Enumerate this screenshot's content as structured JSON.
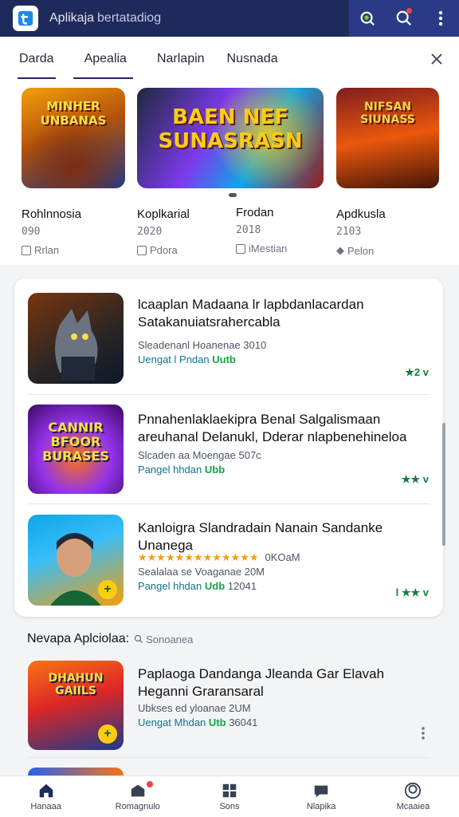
{
  "header": {
    "title": "Aplikaja",
    "subtitle": "bertatadiog"
  },
  "tabs": [
    {
      "label": "Darda"
    },
    {
      "label": "Apealia"
    },
    {
      "label": "Narlapin"
    },
    {
      "label": "Nusnada"
    }
  ],
  "featured": [
    {
      "art_text": "MINHER UNBANAS",
      "name": "Rohlnnosia",
      "year": "090",
      "meta": "Rrlan"
    },
    {
      "art_text": "BAEN NEF SUNASRASN",
      "name": "Koplkarial",
      "year": "2020",
      "meta": "Pdora"
    },
    {
      "art_text": "",
      "name": "Frodan",
      "year": "2018",
      "meta": "iMestian"
    },
    {
      "art_text": "NIFSAN SIUNASS",
      "name": "Apdkusla",
      "year": "2103",
      "meta": "Pelon"
    }
  ],
  "list": [
    {
      "title": "lcaaplan Madaana lr lapbdanlacardan Satakanuiatsrahercabla",
      "meta1": "Sleadenanl Hoanenae 3010",
      "meta2": "Uengat l Pndan",
      "meta2_green": "Uutb",
      "rating": "★2 v"
    },
    {
      "title": "Pnnahenlaklaekipra Benal Salgalismaan areuhanal Delanukl, Dderar nlapbenehineloa",
      "meta1": "Slcaden aa Moengae 507c",
      "meta2": "Pangel hhdan",
      "meta2_green": "Ubb",
      "rating": "★★ v",
      "art_text": "CANNIR BFOOR BURASES"
    },
    {
      "title": "Kanloigra Slandradain Nanain Sandanke Unanega",
      "stars": "★★★★★★★★★★★★★",
      "star_count": "0KOaM",
      "meta1": "Sealalaa se Voaganae 20M",
      "meta2": "Pangel hhdan",
      "meta2_green": "Udb",
      "meta2_num": "12041",
      "rating": "l ★★ v"
    }
  ],
  "section": {
    "heading": "Nevapa Aplciolaa:",
    "hint": "Sonoanea"
  },
  "section_list": [
    {
      "art_text": "DHAHUN GAIILS",
      "title": "Paplaoga Dandanga Jleanda Gar Elavah Heganni Graransaral",
      "meta1": "Ubkses ed yloanae 2UM",
      "meta2": "Uengat Mhdan",
      "meta2_green": "Utb",
      "meta2_num": "36041"
    }
  ],
  "bottom_nav": [
    {
      "label": "Hanaaa"
    },
    {
      "label": "Romagnulo"
    },
    {
      "label": "Sons"
    },
    {
      "label": "Nlapika"
    },
    {
      "label": "Mcaaiea"
    }
  ],
  "colors": {
    "header_bg": "#1f2a5c",
    "accent_green": "#16a34a",
    "link_teal": "#0e7490"
  }
}
